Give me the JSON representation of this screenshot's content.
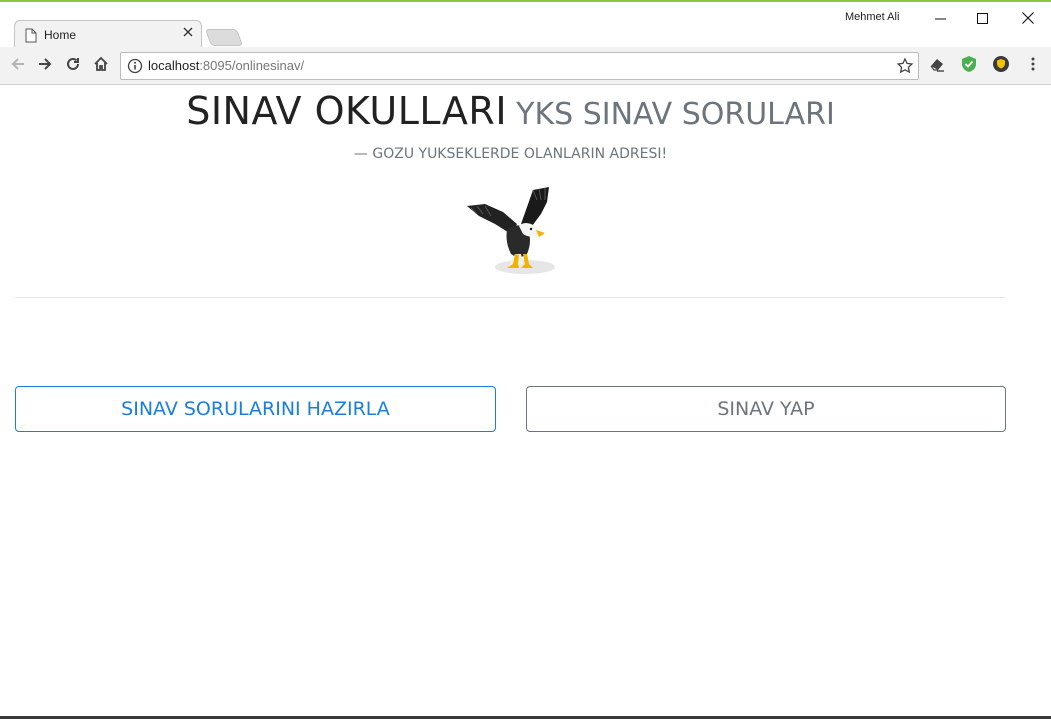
{
  "browser": {
    "tab_title": "Home",
    "user_name": "Mehmet Ali",
    "url_host": "localhost",
    "url_rest": ":8095/onlinesinav/",
    "accent_color": "#8cc63f"
  },
  "header": {
    "title": "SINAV OKULLARI",
    "subtitle": "YKS SINAV SORULARI",
    "tagline": "— GOZU YUKSEKLERDE OLANLARIN ADRESI!"
  },
  "actions": {
    "prepare_label": "SINAV SORULARINI HAZIRLA",
    "take_label": "SINAV YAP",
    "primary_color": "#1a7ee0",
    "secondary_color": "#6c757d"
  },
  "icons": [
    "page-icon",
    "close-icon",
    "minimize-icon",
    "maximize-icon",
    "back-icon",
    "forward-icon",
    "reload-icon",
    "home-icon",
    "info-icon",
    "star-icon",
    "eraser-icon",
    "shield-icon",
    "extension-icon",
    "menu-icon",
    "eagle-image"
  ]
}
